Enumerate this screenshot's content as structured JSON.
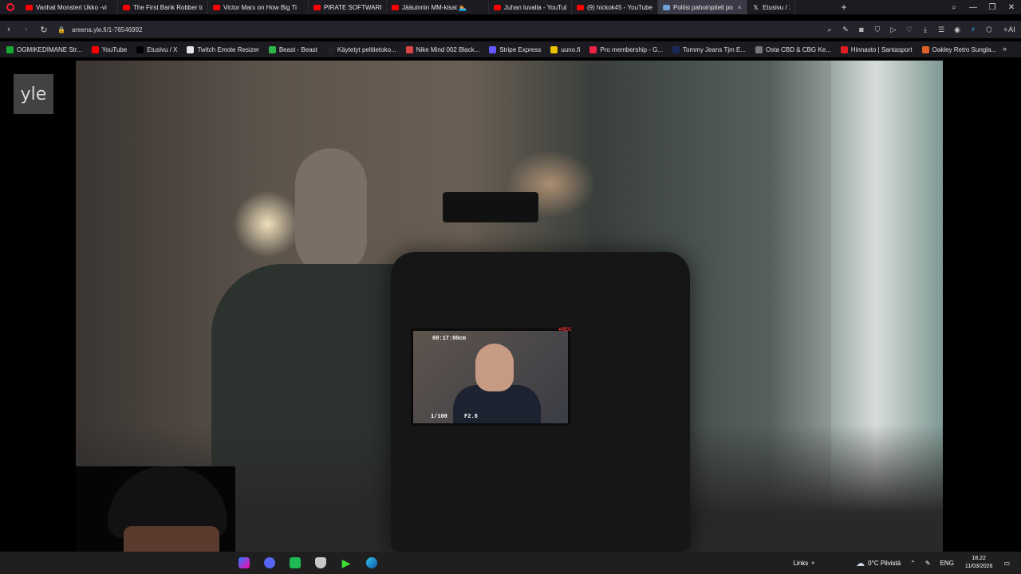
{
  "browser": {
    "tabs": [
      {
        "label": "Vanhat Monsteri Ukko -vi",
        "icon": "youtube-icon",
        "active": false
      },
      {
        "label": "The First Bank Robber to E",
        "icon": "youtube-icon",
        "active": false
      },
      {
        "label": "Victor Marx on How Big Ti",
        "icon": "youtube-icon",
        "active": false
      },
      {
        "label": "PIRATE SOFTWARE TRIED",
        "icon": "youtube-icon",
        "active": false
      },
      {
        "label": "Jääuinnin MM-kisat 🏊🏻",
        "icon": "youtube-icon",
        "active": false
      },
      {
        "label": "Juhan luvalla - YouTube",
        "icon": "youtube-icon",
        "active": false
      },
      {
        "label": "(9) hickok45 - YouTube",
        "icon": "youtube-icon",
        "active": false
      },
      {
        "label": "Poliisi pahoinpiteli po",
        "icon": "yle-icon",
        "active": true
      },
      {
        "label": "Etusivu / X",
        "icon": "x-icon",
        "active": false
      }
    ],
    "new_tab": "+",
    "window_controls": {
      "search": "⌕",
      "minimize": "—",
      "restore": "❐",
      "close": "✕"
    },
    "url": "areena.yle.fi/1-76546992",
    "toolbar": {
      "ai_label": "AI"
    },
    "bookmarks": [
      {
        "label": "OGMIKEDIMANE Str...",
        "color": "#19a834"
      },
      {
        "label": "YouTube",
        "color": "#ff0000"
      },
      {
        "label": "Etusivu / X",
        "color": "#000000"
      },
      {
        "label": "Twitch Emote Resizer",
        "color": "#e6e6e6"
      },
      {
        "label": "Beast - Beast",
        "color": "#2fb84a"
      },
      {
        "label": "Käytetyt pelitietoko...",
        "color": "#222222"
      },
      {
        "label": "Nike Mind 002 Black...",
        "color": "#d44"
      },
      {
        "label": "Stripe Express",
        "color": "#635bff"
      },
      {
        "label": "uuno.fi",
        "color": "#e8c200"
      },
      {
        "label": "Pro membership - G...",
        "color": "#e24"
      },
      {
        "label": "Tommy Jeans Tjm E...",
        "color": "#1c2a5a"
      },
      {
        "label": "Osta CBD & CBG Ke...",
        "color": "#777777"
      },
      {
        "label": "Hinnasto | Santasport",
        "color": "#e02020"
      },
      {
        "label": "Oakley Retro Sungla...",
        "color": "#e0602a"
      }
    ],
    "bookmarks_more": "»"
  },
  "video": {
    "channel_logo": "yle",
    "lcd": {
      "timecode": "00:17:00cm",
      "shutter": "1/100",
      "aperture": "F2.8",
      "rec": "●REC"
    }
  },
  "taskbar": {
    "links_label": "Links",
    "weather": "0°C  Pilvistä",
    "lang": "ENG",
    "time": "18.22",
    "date": "11/03/2026"
  }
}
